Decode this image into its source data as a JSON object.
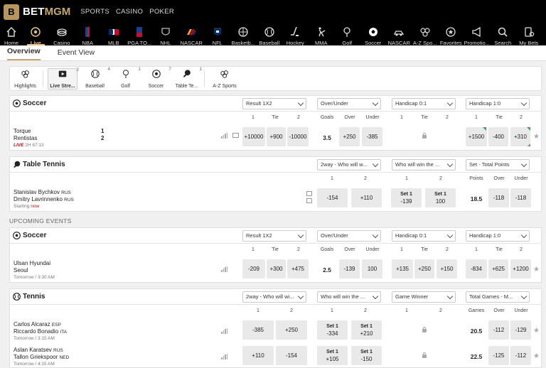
{
  "brand": {
    "mark": "B",
    "bet": "BET",
    "mgm": "MGM"
  },
  "topnav": [
    "SPORTS",
    "CASINO",
    "POKER"
  ],
  "sportnav": [
    {
      "label": "Home",
      "icon": "home-icon"
    },
    {
      "label": "Live",
      "icon": "live-icon",
      "active": true
    },
    {
      "label": "Casino",
      "icon": "casino-icon"
    },
    {
      "label": "NBA",
      "icon": "nba-icon"
    },
    {
      "label": "MLB",
      "icon": "mlb-icon"
    },
    {
      "label": "PGA TO...",
      "icon": "pga-icon"
    },
    {
      "label": "NHL",
      "icon": "nhl-icon"
    },
    {
      "label": "NASCAR",
      "icon": "nascar-icon"
    },
    {
      "label": "NFL",
      "icon": "nfl-icon"
    },
    {
      "label": "Basketb...",
      "icon": "basketball-icon"
    },
    {
      "label": "Baseball",
      "icon": "baseball-icon"
    },
    {
      "label": "Hockey",
      "icon": "hockey-icon"
    },
    {
      "label": "MMA",
      "icon": "mma-icon"
    },
    {
      "label": "Golf",
      "icon": "golf-icon"
    },
    {
      "label": "Soccer",
      "icon": "soccer-icon"
    },
    {
      "label": "NASCAR",
      "icon": "nascar-car-icon"
    },
    {
      "label": "A-Z Spo...",
      "icon": "az-sports-icon"
    },
    {
      "label": "Favorites",
      "icon": "favorites-icon"
    },
    {
      "label": "Promotio...",
      "icon": "promotions-icon"
    },
    {
      "label": "Search",
      "icon": "search-icon"
    },
    {
      "label": "My Bets",
      "icon": "my-bets-icon"
    }
  ],
  "tabs": {
    "overview": "Overview",
    "event_view": "Event View"
  },
  "filters": [
    {
      "label": "Highlights",
      "count": "",
      "icon": "highlights-icon"
    },
    {
      "label": "Live Stre...",
      "count": "2",
      "icon": "live-stream-icon",
      "active": true
    },
    {
      "label": "Baseball",
      "count": "4",
      "icon": "baseball-icon"
    },
    {
      "label": "Golf",
      "count": "1",
      "icon": "golf-icon"
    },
    {
      "label": "Soccer",
      "count": "7",
      "icon": "soccer-icon"
    },
    {
      "label": "Table Te...",
      "count": "1",
      "icon": "table-tennis-icon"
    },
    {
      "label": "A-Z Sports",
      "count": "",
      "icon": "az-sports-icon"
    }
  ],
  "soccer_live": {
    "title": "Soccer",
    "dropdowns": [
      "Result 1X2",
      "Over/Under",
      "Handicap 0:1",
      "Handicap 1:0"
    ],
    "headers": [
      "1",
      "Tie",
      "2",
      "Goals",
      "Over",
      "Under",
      "1",
      "Tie",
      "2",
      "1",
      "Tie",
      "2"
    ],
    "team1": "Torque",
    "team2": "Rentistas",
    "score1": "1",
    "score2": "2",
    "live": "LIVE",
    "time": "2H 87:13",
    "odds": [
      "+10000",
      "+900",
      "-10000",
      "3.5",
      "+250",
      "-385",
      "+1500",
      "-400",
      "+310"
    ]
  },
  "table_tennis": {
    "title": "Table Tennis",
    "dropdowns": [
      "2way - Who will w...",
      "Who will win the ...",
      "Set - Total Points"
    ],
    "headers": [
      "1",
      "2",
      "1",
      "2",
      "Points",
      "Over",
      "Under"
    ],
    "team1": "Stanislav Bychkov",
    "c1": "RUS",
    "team2": "Dmitry Lavrinnenko",
    "c2": "RUS",
    "starting": "Starting",
    "now": "now",
    "odds": [
      "-154",
      "+110",
      "Set 1",
      "-139",
      "Set 1",
      "100",
      "18.5",
      "-118",
      "-118"
    ]
  },
  "upcoming_label": "UPCOMING EVENTS",
  "soccer_up": {
    "title": "Soccer",
    "dropdowns": [
      "Result 1X2",
      "Over/Under",
      "Handicap 0:1",
      "Handicap 1:0"
    ],
    "headers": [
      "1",
      "Tie",
      "2",
      "Goals",
      "Over",
      "Under",
      "1",
      "Tie",
      "2",
      "1",
      "Tie",
      "2"
    ],
    "team1": "Ulsan Hyundai",
    "team2": "Seoul",
    "time": "Tomorrow / 3:30 AM",
    "odds": [
      "-209",
      "+300",
      "+475",
      "2.5",
      "-139",
      "100",
      "+135",
      "+250",
      "+150",
      "-834",
      "+625",
      "+1200"
    ]
  },
  "tennis": {
    "title": "Tennis",
    "dropdowns": [
      "2way - Who will wi...",
      "Who will win the ...",
      "Game Winner",
      "Total Games - M..."
    ],
    "headers": [
      "1",
      "2",
      "1",
      "2",
      "1",
      "2",
      "Games",
      "Over",
      "Under"
    ],
    "rows": [
      {
        "team1": "Carlos Alcaraz",
        "c1": "ESP",
        "team2": "Riccardo Bonadio",
        "c2": "ITA",
        "time": "Tomorrow / 3:15 AM",
        "odds": [
          "-385",
          "+250",
          "Set 1",
          "-334",
          "Set 1",
          "+210",
          "20.5",
          "-112",
          "-129"
        ]
      },
      {
        "team1": "Aslan Karatsev",
        "c1": "RUS",
        "team2": "Tallon Griekspoor",
        "c2": "NED",
        "time": "Tomorrow / 4:15 AM",
        "odds": [
          "+110",
          "-154",
          "Set 1",
          "+105",
          "Set 1",
          "-150",
          "22.5",
          "-125",
          "-112"
        ]
      }
    ]
  }
}
